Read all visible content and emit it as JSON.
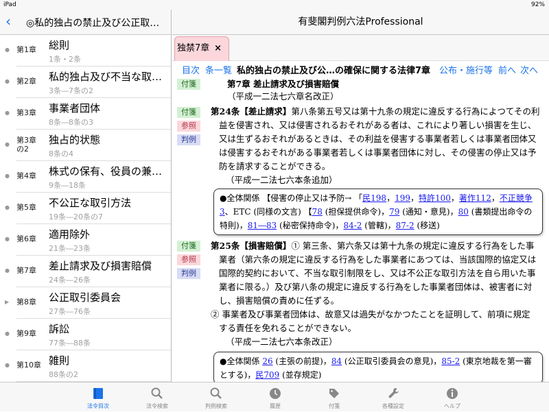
{
  "status": {
    "device": "iPad",
    "battery": "92%"
  },
  "left": {
    "title": "◎私的独占の禁止及び公正取…",
    "chapters": [
      {
        "num": "第1章",
        "title": "総則",
        "sub": "1条・2条"
      },
      {
        "num": "第2章",
        "title": "私的独占及び不当な取…",
        "sub": "3条―7条の2"
      },
      {
        "num": "第3章",
        "title": "事業者団体",
        "sub": "8条―8条の3"
      },
      {
        "num": "第3章の2",
        "title": "独占的状態",
        "sub": "8条の4"
      },
      {
        "num": "第4章",
        "title": "株式の保有、役員の兼…",
        "sub": "9条―18条"
      },
      {
        "num": "第5章",
        "title": "不公正な取引方法",
        "sub": "19条―20条の7"
      },
      {
        "num": "第6章",
        "title": "適用除外",
        "sub": "21条―23条"
      },
      {
        "num": "第7章",
        "title": "差止請求及び損害賠償",
        "sub": "24条―26条"
      },
      {
        "num": "第8章",
        "title": "公正取引委員会",
        "sub": "27条―76条"
      },
      {
        "num": "第9章",
        "title": "訴訟",
        "sub": "77条―88条"
      },
      {
        "num": "第10章",
        "title": "雑則",
        "sub": "88条の2"
      }
    ]
  },
  "right": {
    "app_title": "有斐閣判例六法Professional",
    "tab_label": "独禁7章",
    "tab_close": "×",
    "nav": {
      "toc": "目次",
      "list": "条一覧",
      "law_title": "私的独占の禁止及び公…の確保に関する法律7章",
      "enact": "公布・施行等",
      "prev": "前へ",
      "next": "次へ"
    },
    "tags": {
      "fusen": "付箋",
      "sansho": "参照",
      "hanrei": "判例"
    },
    "chapter_heading": "第7章 差止請求及び損害賠償",
    "chapter_note": "（平成一二法七六章名改正）",
    "art24": {
      "label": "第24条【差止請求】",
      "lines": [
        "第八条第五号又は第十九条の規定に違反する行為によつてその利",
        "益を侵害され、又は侵害されるおそれがある者は、これにより著しい損害を生じ、",
        "又は生ずるおそれがあるときは、その利益を侵害する事業者若しくは事業者団体又",
        "は侵害するおそれがある事業者若しくは事業者団体に対し、その侵害の停止又は予",
        "防を請求することができる。"
      ],
      "note": "（平成一二法七六本条追加）"
    },
    "box24": {
      "head": "●全体関係 【侵害の停止又は予防→ 「",
      "l1": [
        "民198",
        "199",
        "特許100",
        "著作112",
        "不正競争3"
      ],
      "l1_tail": "、ETC (同様の文言) 【",
      "l2": [
        {
          "r": "78",
          "t": "(担保提供命令)"
        },
        {
          "r": "79",
          "t": "(通知・意見)"
        },
        {
          "r": "80",
          "t": "(書類提出命令の特則)"
        },
        {
          "r": "81―83",
          "t": "(秘密保持命令)"
        },
        {
          "r": "84-2",
          "t": "(管轄)"
        },
        {
          "r": "87-2",
          "t": "(移送)"
        }
      ]
    },
    "art25": {
      "label": "第25条【損害賠償】",
      "p1_lead": "① 第三条、第六条又は第十九条の規定に違反する行為をした事",
      "p1_lines": [
        "業者（第六条の規定に違反する行為をした事業者にあつては、当該国際的協定又は",
        "国際的契約において、不当な取引制限をし、又は不公正な取引方法を自ら用いた事",
        "業者に限る。）及び第八条の規定に違反する行為をした事業者団体は、被害者に対",
        "し、損害賠償の責めに任ずる。"
      ],
      "p2_lines": [
        "② 事業者及び事業者団体は、故意又は過失がなかつたことを証明して、前項に規定",
        "する責任を免れることができない。"
      ],
      "note": "（平成一二法七六本条改正）"
    },
    "box25": {
      "head": "●全体関係",
      "items": [
        {
          "r": "26",
          "t": "(主張の前提)"
        },
        {
          "r": "84",
          "t": "(公正取引委員会の意見)"
        },
        {
          "r": "85-2",
          "t": "(東京地裁を第一審とする)"
        },
        {
          "r": "民709",
          "t": "(並存規定)"
        }
      ]
    }
  },
  "tabbar": [
    {
      "label": "法令目次",
      "icon": "book-icon",
      "active": true
    },
    {
      "label": "法令検索",
      "icon": "search-icon"
    },
    {
      "label": "判例検索",
      "icon": "search-icon"
    },
    {
      "label": "履歴",
      "icon": "clock-icon"
    },
    {
      "label": "付箋",
      "icon": "tag-icon"
    },
    {
      "label": "各種設定",
      "icon": "wrench-icon"
    },
    {
      "label": "ヘルプ",
      "icon": "info-icon"
    }
  ],
  "colors": {
    "accent": "#1a73e8",
    "tab_pink": "#fbd7dc"
  }
}
